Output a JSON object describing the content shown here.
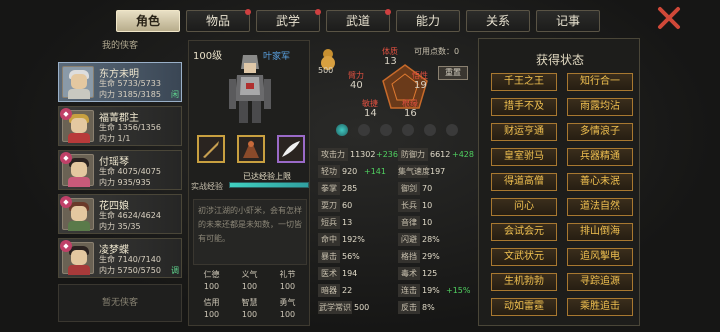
{
  "tabs": [
    {
      "label": "角色",
      "active": true
    },
    {
      "label": "物品",
      "dot": true
    },
    {
      "label": "武学",
      "dot": true
    },
    {
      "label": "武道",
      "dot": true
    },
    {
      "label": "能力"
    },
    {
      "label": "关系"
    },
    {
      "label": "记事"
    }
  ],
  "roster": {
    "title": "我的侠客",
    "empty_label": "暂无侠客",
    "characters": [
      {
        "name": "东方未明",
        "hp": "生命 5733/5733",
        "mp": "内力 3185/3185",
        "tag": "闲",
        "selected": true
      },
      {
        "name": "福菁郡主",
        "hp": "生命 1356/1356",
        "mp": "内力 1/1",
        "badge": "◆"
      },
      {
        "name": "付瑶琴",
        "hp": "生命 4075/4075",
        "mp": "内力 935/935",
        "badge": "◆"
      },
      {
        "name": "花四娘",
        "hp": "生命 4624/4624",
        "mp": "内力 35/35",
        "badge": "◆"
      },
      {
        "name": "凌梦蝶",
        "hp": "生命 7140/7140",
        "mp": "内力 5750/5750",
        "tag": "调",
        "badge": "◆"
      }
    ]
  },
  "profile": {
    "level": "100级",
    "faction": "叶家军",
    "exp_label": "实战经验",
    "exp_status": "已达经验上限",
    "exp_fill": 1.0,
    "description": "初涉江湖的小虾米，会有怎样的未来还都是未知数，一切皆有可能。",
    "virtues": [
      {
        "label": "仁德",
        "value": "100"
      },
      {
        "label": "义气",
        "value": "100"
      },
      {
        "label": "礼节",
        "value": "100"
      },
      {
        "label": "信用",
        "value": "100"
      },
      {
        "label": "智慧",
        "value": "100"
      },
      {
        "label": "勇气",
        "value": "100"
      }
    ]
  },
  "attributes": {
    "potential": "500",
    "free_points_label": "可用点数：0",
    "reset_label": "重置",
    "tizhi": {
      "label": "体质",
      "value": "13"
    },
    "biji": {
      "label": "臂力",
      "value": "40"
    },
    "wuxing": {
      "label": "悟性",
      "value": "19"
    },
    "minjie": {
      "label": "敏捷",
      "value": "14"
    },
    "genyuan": {
      "label": "根缘",
      "value": "16"
    }
  },
  "stats_left": [
    {
      "label": "攻击力",
      "value": "11302",
      "bonus": "+2365"
    },
    {
      "label": "轻功",
      "value": "920",
      "bonus": "+141"
    },
    {
      "label": "拳掌",
      "value": "285"
    },
    {
      "label": "耍刀",
      "value": "60"
    },
    {
      "label": "短兵",
      "value": "13"
    },
    {
      "label": "命中",
      "value": "192%"
    },
    {
      "label": "暴击",
      "value": "56%"
    },
    {
      "label": "医术",
      "value": "194"
    },
    {
      "label": "暗器",
      "value": "22"
    },
    {
      "label": "武学常识",
      "value": "500"
    }
  ],
  "stats_right": [
    {
      "label": "防御力",
      "value": "6612",
      "bonus": "+428"
    },
    {
      "label": "集气速度",
      "value": "197"
    },
    {
      "label": "御剑",
      "value": "70"
    },
    {
      "label": "长兵",
      "value": "10"
    },
    {
      "label": "音律",
      "value": "10"
    },
    {
      "label": "闪避",
      "value": "28%"
    },
    {
      "label": "格挡",
      "value": "29%"
    },
    {
      "label": "毒术",
      "value": "125"
    },
    {
      "label": "连击",
      "value": "19%",
      "bonus": "+15%"
    },
    {
      "label": "反击",
      "value": "8%"
    }
  ],
  "states": {
    "title": "获得状态",
    "items": [
      "千王之王",
      "知行合一",
      "措手不及",
      "雨露均沾",
      "财运亨通",
      "多情浪子",
      "皇室驸马",
      "兵器精通",
      "得道高僧",
      "善心未泯",
      "问心",
      "道法自然",
      "会试会元",
      "排山倒海",
      "文武状元",
      "追风掣电",
      "生机勃勃",
      "寻踪追源",
      "动如雷霆",
      "乘胜追击"
    ]
  },
  "colors": {
    "accent_gold": "#f0c050",
    "selected_tab": "#e8dfc4",
    "alert_red": "#d04040"
  }
}
